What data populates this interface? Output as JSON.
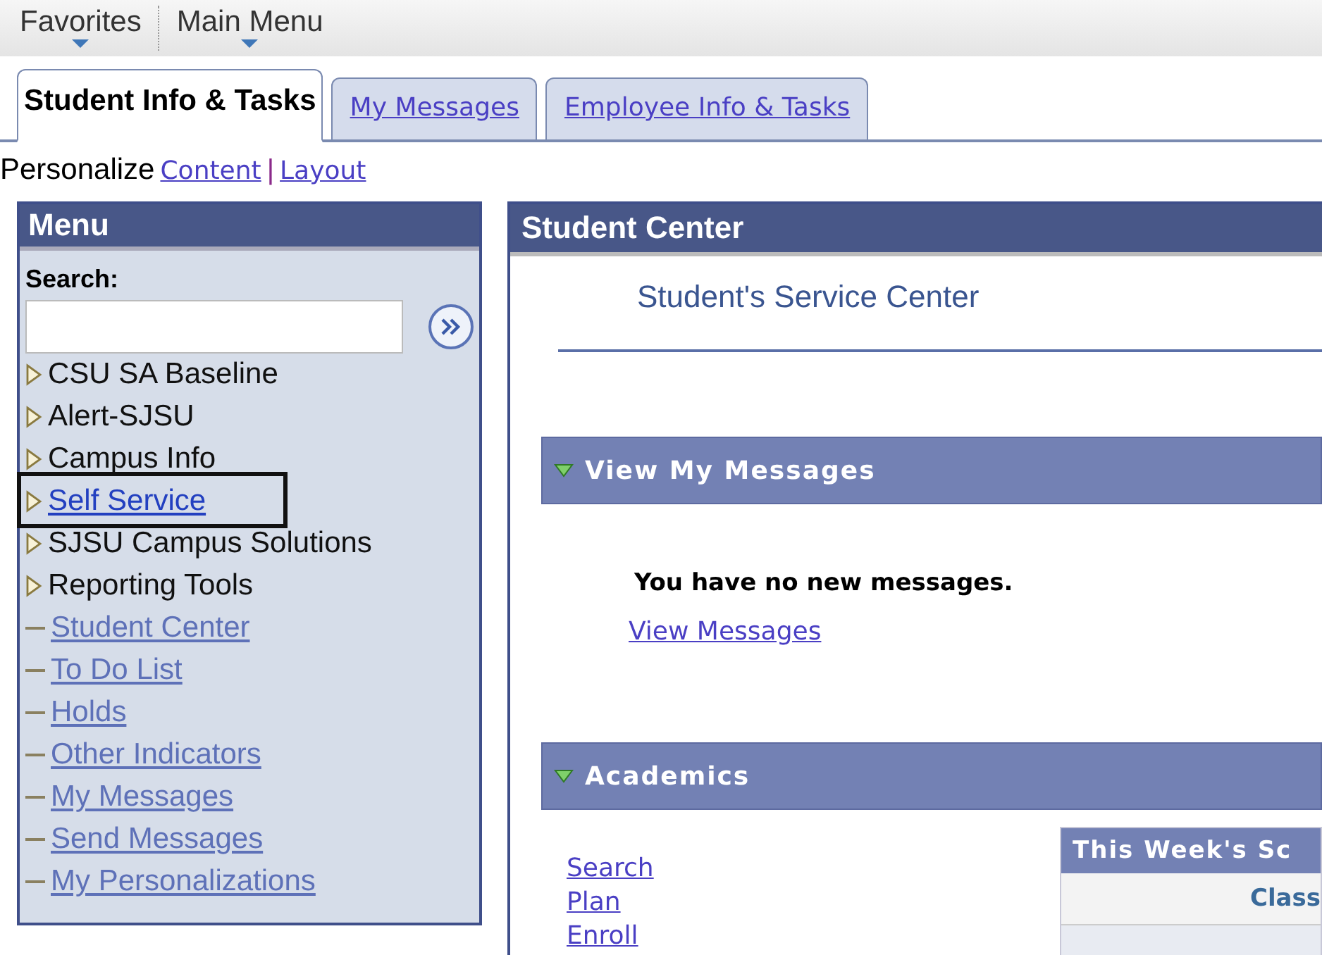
{
  "top_menu": [
    {
      "label": "Favorites"
    },
    {
      "label": "Main Menu"
    }
  ],
  "tabs": [
    {
      "label": "Student Info & Tasks",
      "selected": true
    },
    {
      "label": "My Messages",
      "selected": false
    },
    {
      "label": "Employee Info & Tasks",
      "selected": false
    }
  ],
  "personalize": {
    "label": "Personalize",
    "links": [
      "Content",
      "Layout"
    ],
    "separator": "|"
  },
  "menu": {
    "title": "Menu",
    "search_label": "Search:",
    "items": [
      {
        "kind": "folder",
        "label": "CSU SA Baseline",
        "link": false,
        "highlighted": false
      },
      {
        "kind": "folder",
        "label": "Alert-SJSU",
        "link": false,
        "highlighted": false
      },
      {
        "kind": "folder",
        "label": "Campus Info",
        "link": false,
        "highlighted": false
      },
      {
        "kind": "folder",
        "label": "Self Service",
        "link": true,
        "highlighted": true
      },
      {
        "kind": "folder",
        "label": "SJSU Campus Solutions",
        "link": false,
        "highlighted": false
      },
      {
        "kind": "folder",
        "label": "Reporting Tools",
        "link": false,
        "highlighted": false
      },
      {
        "kind": "page",
        "label": "Student Center",
        "link": true,
        "highlighted": false
      },
      {
        "kind": "page",
        "label": "To Do List",
        "link": true,
        "highlighted": false
      },
      {
        "kind": "page",
        "label": "Holds",
        "link": true,
        "highlighted": false
      },
      {
        "kind": "page",
        "label": "Other Indicators",
        "link": true,
        "highlighted": false
      },
      {
        "kind": "page",
        "label": "My Messages",
        "link": true,
        "highlighted": false
      },
      {
        "kind": "page",
        "label": "Send Messages",
        "link": true,
        "highlighted": false
      },
      {
        "kind": "page",
        "label": "My Personalizations",
        "link": true,
        "highlighted": false
      }
    ]
  },
  "student_center": {
    "title": "Student Center",
    "subtitle": "Student's Service Center",
    "messages": {
      "title": "View My Messages",
      "expanded": true,
      "text": "You have no new messages.",
      "link": "View Messages"
    },
    "academics": {
      "title": "Academics",
      "expanded": true,
      "links": [
        "Search",
        "Plan",
        "Enroll"
      ],
      "schedule": {
        "title": "This Week's Sc",
        "column_1": "Class"
      }
    }
  }
}
